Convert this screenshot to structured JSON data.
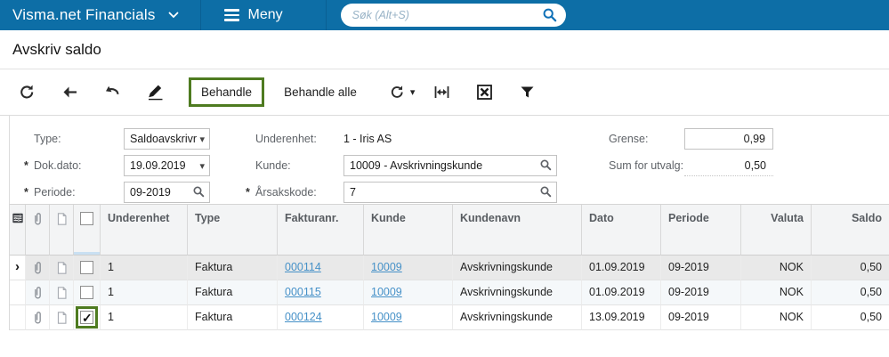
{
  "colors": {
    "topbar_bg": "#0d6ea6",
    "link": "#4691c8",
    "annotation_green": "#4e7b20",
    "selected_row_bg": "#e9e9e9",
    "selected_cell_bg": "#cfe3f3"
  },
  "topbar": {
    "brand": "Visma.net Financials",
    "menu_label": "Meny",
    "search_placeholder": "Søk (Alt+S)"
  },
  "page": {
    "title": "Avskriv saldo"
  },
  "toolbar": {
    "behandle_label": "Behandle",
    "behandle_alle_label": "Behandle alle"
  },
  "glyphs": {
    "chevron_down": "▾",
    "row_pointer": "›"
  },
  "filters": {
    "type": {
      "label": "Type:",
      "value": "Saldoavskrivr"
    },
    "dok_dato": {
      "label": "Dok.dato:",
      "required_mark": "*",
      "value": "19.09.2019"
    },
    "periode": {
      "label": "Periode:",
      "required_mark": "*",
      "value": "09-2019"
    },
    "underenhet": {
      "label": "Underenhet:",
      "value": "1 - Iris AS"
    },
    "kunde": {
      "label": "Kunde:",
      "value": "10009 - Avskrivningskunde"
    },
    "arsakskode": {
      "label": "Årsakskode:",
      "required_mark": "*",
      "value": "7"
    },
    "grense": {
      "label": "Grense:",
      "value": "0,99"
    },
    "sum_for_utvalg": {
      "label": "Sum for utvalg:",
      "value": "0,50"
    }
  },
  "grid": {
    "headers": {
      "underenhet": "Underenhet",
      "type": "Type",
      "fakturanr": "Fakturanr.",
      "kunde": "Kunde",
      "kundenavn": "Kundenavn",
      "dato": "Dato",
      "periode": "Periode",
      "valuta": "Valuta",
      "saldo": "Saldo"
    },
    "rows": [
      {
        "selected": true,
        "checked": false,
        "underenhet": "1",
        "type": "Faktura",
        "fakturanr": "000114",
        "kunde": "10009",
        "kundenavn": "Avskrivningskunde",
        "dato": "01.09.2019",
        "periode": "09-2019",
        "valuta": "NOK",
        "saldo": "0,50"
      },
      {
        "selected": false,
        "checked": false,
        "underenhet": "1",
        "type": "Faktura",
        "fakturanr": "000115",
        "kunde": "10009",
        "kundenavn": "Avskrivningskunde",
        "dato": "01.09.2019",
        "periode": "09-2019",
        "valuta": "NOK",
        "saldo": "0,50"
      },
      {
        "selected": false,
        "checked": true,
        "underenhet": "1",
        "type": "Faktura",
        "fakturanr": "000124",
        "kunde": "10009",
        "kundenavn": "Avskrivningskunde",
        "dato": "13.09.2019",
        "periode": "09-2019",
        "valuta": "NOK",
        "saldo": "0,50"
      }
    ]
  }
}
